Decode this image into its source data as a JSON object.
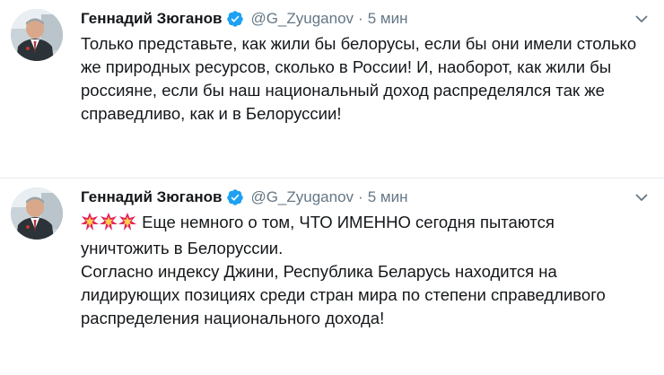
{
  "tweets": [
    {
      "author_name": "Геннадий Зюганов",
      "handle": "@G_Zyuganov",
      "separator": "·",
      "time": "5 мин",
      "lines": [
        "Только представьте, как жили бы белорусы, если бы они имели столько",
        "же природных ресурсов, сколько в России! И, наоборот, как жили бы",
        "россияне, если бы наш национальный доход распределялся так же",
        "справедливо, как и в Белоруссии!"
      ]
    },
    {
      "author_name": "Геннадий Зюганов",
      "handle": "@G_Zyuganov",
      "separator": "·",
      "time": "5 мин",
      "emoji": [
        "💥",
        "💥",
        "💥"
      ],
      "lines": [
        "Еще немного о том, ЧТО ИМЕННО сегодня пытаются",
        "уничтожить в Белоруссии.",
        "Согласно индексу Джини,  Республика Беларусь находится на",
        "лидирующих позициях среди стран мира по степени справедливого",
        "распределения национального дохода!"
      ]
    }
  ],
  "colors": {
    "text": "#14171a",
    "secondary": "#657786",
    "verified": "#1da1f2",
    "divider": "#e6ecf0",
    "emoji": "#e0245e"
  },
  "icons": {
    "verified": "verified-badge-icon",
    "caret": "chevron-down-icon",
    "emoji": "collision-icon"
  }
}
